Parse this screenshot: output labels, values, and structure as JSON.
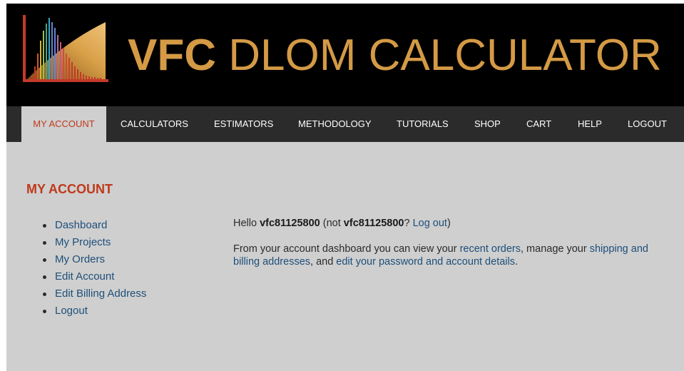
{
  "header": {
    "logo": "vfc-logo-chart-icon",
    "title_bold": "VFC",
    "title_rest": " DLOM CALCULATOR"
  },
  "nav": {
    "items": [
      {
        "label": "MY ACCOUNT",
        "active": true
      },
      {
        "label": "CALCULATORS"
      },
      {
        "label": "ESTIMATORS"
      },
      {
        "label": "METHODOLOGY"
      },
      {
        "label": "TUTORIALS"
      },
      {
        "label": "SHOP"
      },
      {
        "label": "CART"
      },
      {
        "label": "HELP"
      },
      {
        "label": "LOGOUT"
      }
    ]
  },
  "sidebar": {
    "title": "MY ACCOUNT",
    "items": [
      {
        "label": "Dashboard"
      },
      {
        "label": "My Projects"
      },
      {
        "label": "My Orders"
      },
      {
        "label": "Edit Account"
      },
      {
        "label": "Edit Billing Address"
      },
      {
        "label": "Logout"
      }
    ]
  },
  "main": {
    "hello_prefix": "Hello ",
    "username": "vfc81125800",
    "hello_middle": " (not ",
    "username_repeat": "vfc81125800",
    "hello_q": "? ",
    "logout_link": "Log out",
    "hello_close": ")",
    "dash_prefix": "From your account dashboard you can view your ",
    "recent_orders_link": "recent orders",
    "dash_middle1": ", manage your ",
    "addresses_link": "shipping and billing addresses",
    "dash_middle2": ", and ",
    "account_details_link": "edit your password and account details",
    "dash_end": "."
  },
  "colors": {
    "brand_gold": "#d49a45",
    "accent_red": "#c0391b",
    "link_blue": "#1d4f7a",
    "nav_bg": "#2b2b2b",
    "page_bg": "#cfcfcf"
  }
}
